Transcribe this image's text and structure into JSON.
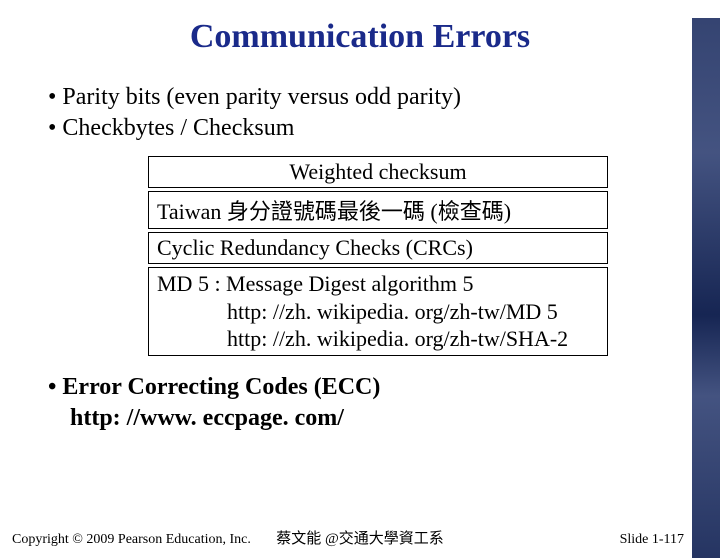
{
  "title": "Communication Errors",
  "bullets": {
    "b1": "•  Parity bits (even parity versus odd parity)",
    "b2": "•  Checkbytes / Checksum",
    "b3_label": "•  Error Correcting Codes  (ECC)",
    "b3_url": "http: //www. eccpage. com/"
  },
  "boxes": {
    "weighted": "Weighted checksum",
    "taiwan": "Taiwan 身分證號碼最後一碼 (檢查碼)",
    "crc": "Cyclic Redundancy Checks (CRCs)",
    "md5_line1": "MD 5 : Message Digest algorithm 5",
    "md5_line2": "http: //zh. wikipedia. org/zh-tw/MD 5",
    "md5_line3": "http: //zh. wikipedia. org/zh-tw/SHA-2"
  },
  "footer": {
    "copyright": "Copyright © 2009 Pearson Education, Inc.",
    "center": "蔡文能 @交通大學資工系",
    "slide": "Slide 1-117"
  }
}
